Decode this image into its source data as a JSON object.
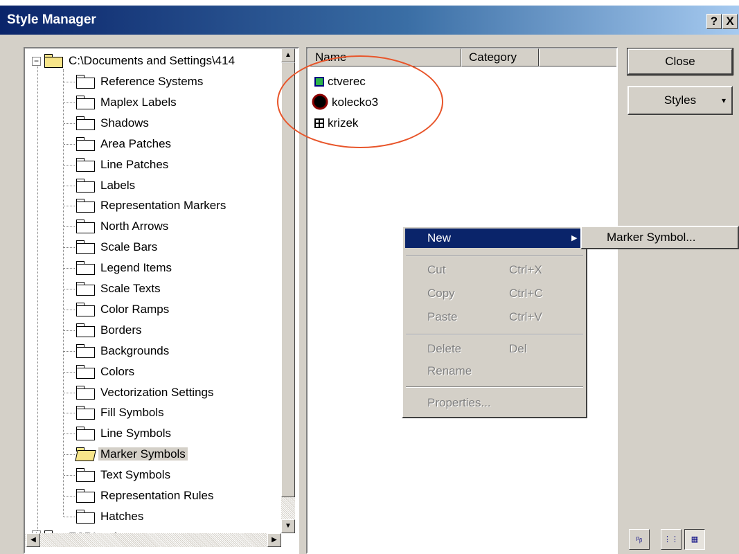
{
  "window": {
    "title": "Style Manager",
    "help_button": "?",
    "close_button": "X"
  },
  "tree": {
    "root_path": "C:\\Documents and Settings\\414",
    "folders": [
      "Reference Systems",
      "Maplex Labels",
      "Shadows",
      "Area Patches",
      "Line Patches",
      "Labels",
      "Representation Markers",
      "North Arrows",
      "Scale Bars",
      "Legend Items",
      "Scale Texts",
      "Color Ramps",
      "Borders",
      "Backgrounds",
      "Colors",
      "Vectorization Settings",
      "Fill Symbols",
      "Line Symbols",
      "Marker Symbols",
      "Text Symbols",
      "Representation Rules",
      "Hatches"
    ],
    "selected": "Marker Symbols",
    "second_root": "ESRI.style"
  },
  "list": {
    "columns": [
      "Name",
      "Category"
    ],
    "items": [
      {
        "name": "ctverec",
        "icon": "green-square-icon"
      },
      {
        "name": "kolecko3",
        "icon": "black-circle-icon"
      },
      {
        "name": "krizek",
        "icon": "crossed-square-icon"
      }
    ]
  },
  "buttons": {
    "close": "Close",
    "styles": "Styles",
    "styles_arrow": "▾"
  },
  "context_menu": {
    "items": [
      {
        "label": "New",
        "shortcut": "",
        "state": "highlighted",
        "submenu_arrow": "▶"
      },
      {
        "label": "Cut",
        "shortcut": "Ctrl+X",
        "state": "disabled"
      },
      {
        "label": "Copy",
        "shortcut": "Ctrl+C",
        "state": "disabled"
      },
      {
        "label": "Paste",
        "shortcut": "Ctrl+V",
        "state": "disabled"
      },
      {
        "label": "Delete",
        "shortcut": "Del",
        "state": "disabled"
      },
      {
        "label": "Rename",
        "shortcut": "",
        "state": "disabled"
      },
      {
        "label": "Properties...",
        "shortcut": "",
        "state": "disabled"
      }
    ],
    "submenu": {
      "item": "Marker Symbol..."
    }
  },
  "colors": {
    "title_bar_start": "#0a246a",
    "highlight": "#0a246a",
    "annotation_oval": "#e8552a",
    "dialog_face": "#d4d0c8"
  }
}
